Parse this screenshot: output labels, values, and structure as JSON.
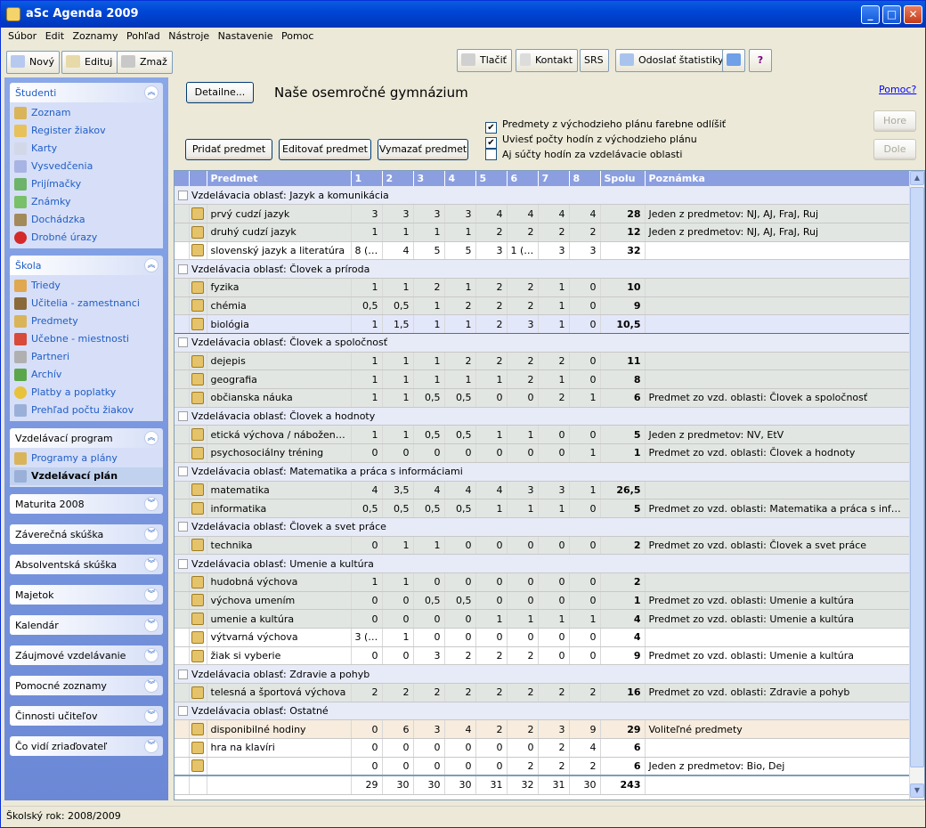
{
  "window": {
    "title": "aSc Agenda 2009"
  },
  "menu": [
    "Súbor",
    "Edit",
    "Zoznamy",
    "Pohľad",
    "Nástroje",
    "Nastavenie",
    "Pomoc"
  ],
  "toolbar": {
    "new": "Nový",
    "edit": "Edituj",
    "delete": "Zmaž",
    "print": "Tlačiť",
    "contact": "Kontakt",
    "srs": "SRS",
    "send_stats": "Odoslať štatistiky"
  },
  "sidebar": {
    "studenti": {
      "title": "Študenti",
      "items": [
        "Zoznam",
        "Register žiakov",
        "Karty",
        "Vysvedčenia",
        "Prijímačky",
        "Známky",
        "Dochádzka",
        "Drobné úrazy"
      ]
    },
    "skola": {
      "title": "Škola",
      "items": [
        "Triedy",
        "Učitelia - zamestnanci",
        "Predmety",
        "Učebne - miestnosti",
        "Partneri",
        "Archív",
        "Platby a poplatky",
        "Prehľad počtu žiakov"
      ]
    },
    "program": {
      "title": "Vzdelávací program",
      "items": [
        "Programy a plány",
        "Vzdelávací plán"
      ]
    },
    "collapsed": [
      "Maturita 2008",
      "Záverečná skúška",
      "Absolventská skúška",
      "Majetok",
      "Kalendár",
      "Záujmové vzdelávanie",
      "Pomocné zoznamy",
      "Činnosti učiteľov",
      "Čo vidí zriaďovateľ"
    ]
  },
  "main": {
    "details_button": "Detailne...",
    "school_name": "Naše osemročné gymnázium",
    "help_link": "Pomoc?",
    "add_subject": "Pridať predmet",
    "edit_subject": "Editovať predmet",
    "delete_subject": "Vymazať predmet",
    "up": "Hore",
    "down": "Dole",
    "options": [
      {
        "label": "Predmety z východzieho plánu farebne odlíšiť",
        "checked": true
      },
      {
        "label": "Uviesť počty hodín z východzieho plánu",
        "checked": true
      },
      {
        "label": "Aj súčty hodín za vzdelávacie oblasti",
        "checked": false
      }
    ]
  },
  "table": {
    "columns": [
      "Predmet",
      "1",
      "2",
      "3",
      "4",
      "5",
      "6",
      "7",
      "8",
      "Spolu",
      "Poznámka"
    ],
    "rows": [
      {
        "type": "area",
        "text": "Vzdelávacia oblasť:  Jazyk a komunikácia"
      },
      {
        "type": "gray",
        "name": "prvý cudzí jazyk",
        "vals": [
          "3",
          "3",
          "3",
          "3",
          "4",
          "4",
          "4",
          "4"
        ],
        "total": "28",
        "note": "Jeden z predmetov: NJ, AJ, FraJ, Ruj"
      },
      {
        "type": "gray",
        "name": "druhý cudzí jazyk",
        "vals": [
          "1",
          "1",
          "1",
          "1",
          "2",
          "2",
          "2",
          "2"
        ],
        "total": "12",
        "note": "Jeden z predmetov: NJ, AJ, FraJ, Ruj"
      },
      {
        "type": "white",
        "name": "slovenský jazyk a literatúra",
        "vals": [
          "8 (4)",
          "4",
          "5",
          "5",
          "3",
          "1 (3)",
          "3",
          "3"
        ],
        "total": "32",
        "note": ""
      },
      {
        "type": "area",
        "text": "Vzdelávacia oblasť:  Človek a príroda"
      },
      {
        "type": "gray",
        "name": "fyzika",
        "vals": [
          "1",
          "1",
          "2",
          "1",
          "2",
          "2",
          "1",
          "0"
        ],
        "total": "10",
        "note": ""
      },
      {
        "type": "gray",
        "name": "chémia",
        "vals": [
          "0,5",
          "0,5",
          "1",
          "2",
          "2",
          "2",
          "1",
          "0"
        ],
        "total": "9",
        "note": ""
      },
      {
        "type": "sel",
        "name": "biológia",
        "vals": [
          "1",
          "1,5",
          "1",
          "1",
          "2",
          "3",
          "1",
          "0"
        ],
        "total": "10,5",
        "note": ""
      },
      {
        "type": "area",
        "text": "Vzdelávacia oblasť:  Človek a spoločnosť"
      },
      {
        "type": "gray",
        "name": "dejepis",
        "vals": [
          "1",
          "1",
          "1",
          "2",
          "2",
          "2",
          "2",
          "0"
        ],
        "total": "11",
        "note": ""
      },
      {
        "type": "gray",
        "name": "geografia",
        "vals": [
          "1",
          "1",
          "1",
          "1",
          "1",
          "2",
          "1",
          "0"
        ],
        "total": "8",
        "note": ""
      },
      {
        "type": "gray",
        "name": "občianska náuka",
        "vals": [
          "1",
          "1",
          "0,5",
          "0,5",
          "0",
          "0",
          "2",
          "1"
        ],
        "total": "6",
        "note": "Predmet zo vzd. oblasti: Človek a spoločnosť"
      },
      {
        "type": "area",
        "text": "Vzdelávacia oblasť:  Človek a hodnoty"
      },
      {
        "type": "gray",
        "name": "etická výchova / náboženská...",
        "vals": [
          "1",
          "1",
          "0,5",
          "0,5",
          "1",
          "1",
          "0",
          "0"
        ],
        "total": "5",
        "note": "Jeden z predmetov: NV, EtV"
      },
      {
        "type": "gray",
        "name": "psychosociálny tréning",
        "vals": [
          "0",
          "0",
          "0",
          "0",
          "0",
          "0",
          "0",
          "1"
        ],
        "total": "1",
        "note": "Predmet zo vzd. oblasti: Človek a hodnoty"
      },
      {
        "type": "area",
        "text": "Vzdelávacia oblasť:  Matematika a práca s informáciami"
      },
      {
        "type": "gray",
        "name": "matematika",
        "vals": [
          "4",
          "3,5",
          "4",
          "4",
          "4",
          "3",
          "3",
          "1"
        ],
        "total": "26,5",
        "note": ""
      },
      {
        "type": "gray",
        "name": "informatika",
        "vals": [
          "0,5",
          "0,5",
          "0,5",
          "0,5",
          "1",
          "1",
          "1",
          "0"
        ],
        "total": "5",
        "note": "Predmet zo vzd. oblasti: Matematika a práca s informácia..."
      },
      {
        "type": "area",
        "text": "Vzdelávacia oblasť:  Človek a svet práce"
      },
      {
        "type": "gray",
        "name": "technika",
        "vals": [
          "0",
          "1",
          "1",
          "0",
          "0",
          "0",
          "0",
          "0"
        ],
        "total": "2",
        "note": "Predmet zo vzd. oblasti: Človek a svet práce"
      },
      {
        "type": "area",
        "text": "Vzdelávacia oblasť:  Umenie a kultúra"
      },
      {
        "type": "gray",
        "name": "hudobná výchova",
        "vals": [
          "1",
          "1",
          "0",
          "0",
          "0",
          "0",
          "0",
          "0"
        ],
        "total": "2",
        "note": ""
      },
      {
        "type": "gray",
        "name": "výchova umením",
        "vals": [
          "0",
          "0",
          "0,5",
          "0,5",
          "0",
          "0",
          "0",
          "0"
        ],
        "total": "1",
        "note": "Predmet zo vzd. oblasti: Umenie a kultúra"
      },
      {
        "type": "gray",
        "name": "umenie a kultúra",
        "vals": [
          "0",
          "0",
          "0",
          "0",
          "1",
          "1",
          "1",
          "1"
        ],
        "total": "4",
        "note": "Predmet zo vzd. oblasti: Umenie a kultúra"
      },
      {
        "type": "white",
        "name": "výtvarná výchova",
        "vals": [
          "3 (1)",
          "1",
          "0",
          "0",
          "0",
          "0",
          "0",
          "0"
        ],
        "total": "4",
        "note": ""
      },
      {
        "type": "white",
        "name": "žiak si vyberie",
        "vals": [
          "0",
          "0",
          "3",
          "2",
          "2",
          "2",
          "0",
          "0"
        ],
        "total": "9",
        "note": "Predmet zo vzd. oblasti: Umenie a kultúra"
      },
      {
        "type": "area",
        "text": "Vzdelávacia oblasť:  Zdravie a pohyb"
      },
      {
        "type": "gray",
        "name": "telesná a športová výchova",
        "vals": [
          "2",
          "2",
          "2",
          "2",
          "2",
          "2",
          "2",
          "2"
        ],
        "total": "16",
        "note": "Predmet zo vzd. oblasti: Zdravie a pohyb"
      },
      {
        "type": "area",
        "text": "Vzdelávacia oblasť:  Ostatné"
      },
      {
        "type": "tan",
        "name": "disponibilné hodiny",
        "vals": [
          "0",
          "6",
          "3",
          "4",
          "2",
          "2",
          "3",
          "9"
        ],
        "total": "29",
        "note": "Voliteľné predmety"
      },
      {
        "type": "white",
        "name": "hra na klavíri",
        "vals": [
          "0",
          "0",
          "0",
          "0",
          "0",
          "0",
          "2",
          "4"
        ],
        "total": "6",
        "note": ""
      },
      {
        "type": "white",
        "name": "",
        "vals": [
          "0",
          "0",
          "0",
          "0",
          "0",
          "2",
          "2",
          "2"
        ],
        "total": "6",
        "note": "Jeden z predmetov: Bio, Dej"
      }
    ],
    "totals": {
      "vals": [
        "29",
        "30",
        "30",
        "30",
        "31",
        "32",
        "31",
        "30"
      ],
      "total": "243"
    }
  },
  "status": "Školský rok: 2008/2009"
}
